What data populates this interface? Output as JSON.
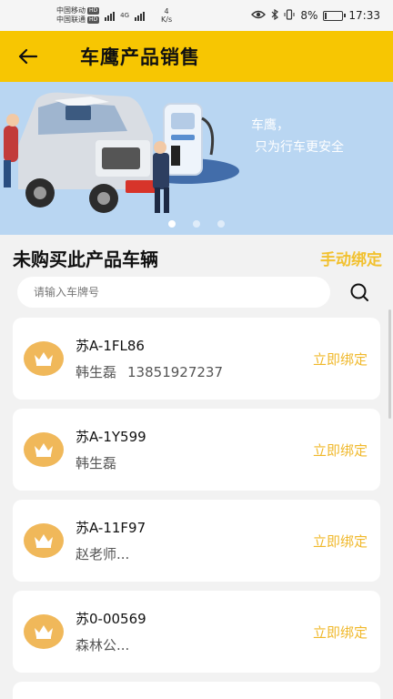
{
  "status_bar": {
    "carrier1": "中国移动",
    "carrier2": "中国联通",
    "hd": "HD",
    "net_type": "4G",
    "speed_value": "4",
    "speed_unit": "K/s",
    "battery_percent": "8%",
    "battery_level": 0.08,
    "time": "17:33"
  },
  "app_bar": {
    "back_icon": "arrow-left-icon",
    "title": "车鹰产品销售"
  },
  "banner": {
    "slogan_line1": "车鹰，",
    "slogan_line2": "只为行车更安全",
    "active_slide": 0,
    "slide_count": 3
  },
  "section": {
    "title": "未购买此产品车辆",
    "manual_bind": "手动绑定"
  },
  "search": {
    "placeholder": "请输入车牌号",
    "value": "",
    "icon": "search-icon"
  },
  "vehicles": [
    {
      "plate": "苏A-1FL86",
      "owner": "韩生磊",
      "phone": "13851927237",
      "action": "立即绑定"
    },
    {
      "plate": "苏A-1Y599",
      "owner": "韩生磊",
      "phone": "",
      "action": "立即绑定"
    },
    {
      "plate": "苏A-11F97",
      "owner": "赵老师...",
      "phone": "",
      "action": "立即绑定"
    },
    {
      "plate": "苏0-00569",
      "owner": "森林公...",
      "phone": "",
      "action": "立即绑定"
    }
  ],
  "colors": {
    "brand_yellow": "#f7c602",
    "action_text": "#f0b82a",
    "crown_bg": "#f0b85a",
    "banner_bg": "#b9d6f2"
  }
}
